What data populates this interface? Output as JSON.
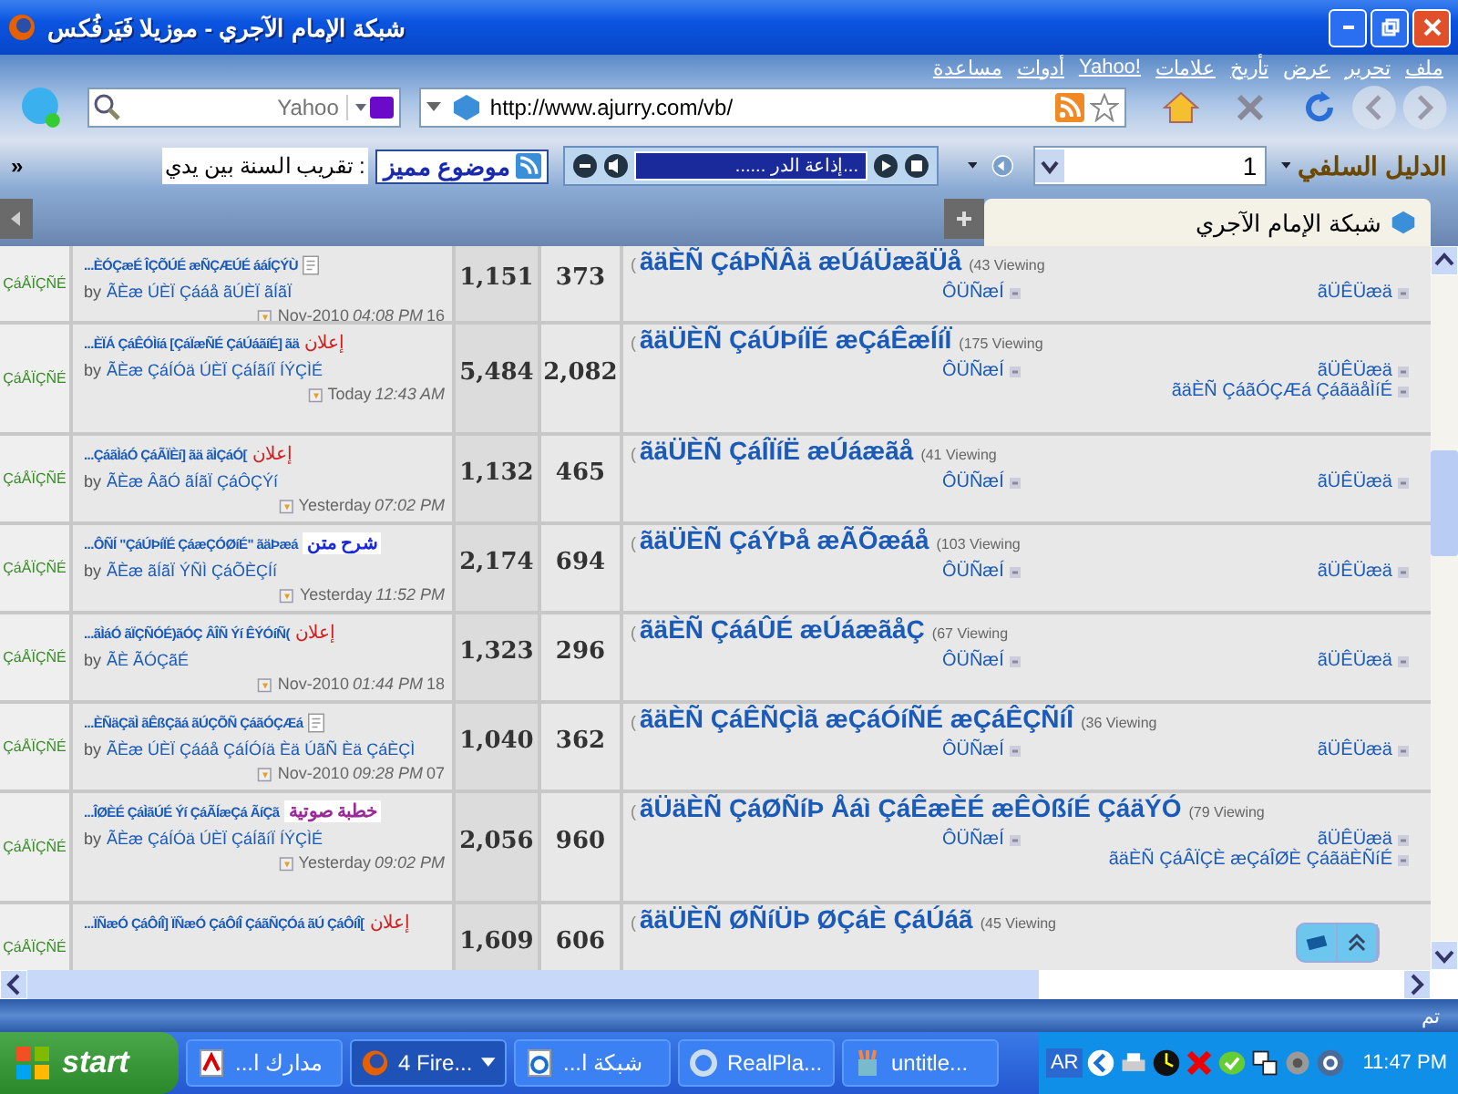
{
  "window": {
    "title": "شبكة الإمام الآجري - موزيلا فَيَرفُكس"
  },
  "menu": [
    "ملف",
    "تحرير",
    "عرض",
    "تأريخ",
    "علامات",
    "Yahoo!",
    "أدوات",
    "مساعدة"
  ],
  "search": {
    "placeholder": "Yahoo"
  },
  "address": {
    "value": "http://www.ajurry.com/vb/"
  },
  "toolbar": {
    "brand": "الدليل السلفي",
    "field_value": "1",
    "radio_station": "...إذاعة الدر ......",
    "featured": "موضوع مميز",
    "ticker": ": تقريب السنة بين يدي",
    "more": "»"
  },
  "tabs": [
    {
      "label": "شبكة الإمام الآجري",
      "selected": true
    }
  ],
  "forums": [
    {
      "prefix": "(",
      "title": "ãäÈÑ ÇáÞÑÂä æÚáÜæãÜå",
      "viewing": "(43 Viewing",
      "links": [
        "ÔÜÑæÍ",
        "ãÜÊÜæä"
      ],
      "column_2": "373",
      "column_3": "1,151",
      "last_post": {
        "title": "...ÈÓÇæÉ ÎÇÕÚÉ æÑÇÆÚÉ ááÍÇÝÙ",
        "attachment": true,
        "by": "by",
        "author": "ÃÈæ ÚÈÏ Çááå ãÚÈÏ ãÍãÏ",
        "date": "Nov-2010",
        "time": "04:08 PM",
        "day": "16"
      },
      "status": "ÇáÅÏÇÑÉ"
    },
    {
      "prefix": "(",
      "title": "ãäÜÈÑ ÇáÚÞíÏÉ æÇáÊæÍíÏ",
      "viewing": "(175 Viewing",
      "links": [
        "ÔÜÑæÍ",
        "ãÜÊÜæä"
      ],
      "extra_link": "ãäÈÑ ÇáãÓÇÆá ÇáãäåÌíÉ",
      "column_2": "2,082",
      "column_3": "5,484",
      "last_post": {
        "title": "...ÈÏÁ ÇáÊÓÌíá [ÇáÏæÑÉ ÇáÚáãíÉ] ãä",
        "tag": {
          "kind": "notice",
          "text": "إعلان"
        },
        "by": "by",
        "author": "ÃÈæ ÇáÍÓä ÚÈÏ ÇáÍãíÏ ÍÝÇÌÉ",
        "date": "Today",
        "time": "12:43 AM"
      },
      "status": "ÇáÅÏÇÑÉ"
    },
    {
      "prefix": "(",
      "title": "ãäÜÈÑ ÇáÍÏíË æÚáæãå",
      "viewing": "(41 Viewing",
      "links": [
        "ÔÜÑæÍ",
        "ãÜÊÜæä"
      ],
      "column_2": "465",
      "column_3": "1,132",
      "last_post": {
        "title": "...ÇáãÌáÓ ÇáÃÏÈí] ãä ãÌÇáÓ[",
        "tag": {
          "kind": "notice",
          "text": "إعلان"
        },
        "by": "by",
        "author": "ÃÈæ ÂãÓ ãÍãÏ ÇáÔÇÝí",
        "date": "Yesterday",
        "time": "07:02 PM"
      },
      "status": "ÇáÅÏÇÑÉ"
    },
    {
      "prefix": "(",
      "title": "ãäÜÈÑ ÇáÝÞå æÃÕæáå",
      "viewing": "(103 Viewing",
      "links": [
        "ÔÜÑæÍ",
        "ãÜÊÜæä"
      ],
      "column_2": "694",
      "column_3": "2,174",
      "last_post": {
        "title": "...ÔÑÍ \"ÇáÚÞíÏÉ ÇáæÇÓØíÉ\" ãäÞæá",
        "tag": {
          "kind": "lesson",
          "text": "شرح متن"
        },
        "by": "by",
        "author": "ÃÈæ ãÍãÏ ÝÑÌ ÇáÕÈÇÍí",
        "date": "Yesterday",
        "time": "11:52 PM"
      },
      "status": "ÇáÅÏÇÑÉ"
    },
    {
      "prefix": "(",
      "title": "ãäÈÑ ÇááÛÉ æÚáæãåÇ",
      "viewing": "(67 Viewing",
      "links": [
        "ÔÜÑæÍ",
        "ãÜÊÜæä"
      ],
      "column_2": "296",
      "column_3": "1,323",
      "last_post": {
        "title": "...ãÌáÓ ãÏÇÑÓÉ)ãÓÇ ÂÎÑ Ýí ÊÝÓíÑ(",
        "tag": {
          "kind": "notice",
          "text": "إعلان"
        },
        "by": "by",
        "author": "ÃÈ ÃÓÇãÉ",
        "date": "Nov-2010",
        "time": "01:44 PM",
        "day": "18"
      },
      "status": "ÇáÅÏÇÑÉ"
    },
    {
      "prefix": "(",
      "title": "ãäÈÑ ÇáÊÑÇÌã æÇáÓíÑÉ æÇáÊÇÑíÎ",
      "viewing": "(36 Viewing",
      "links": [
        "ÔÜÑæÍ",
        "ãÜÊÜæä"
      ],
      "column_2": "362",
      "column_3": "1,040",
      "last_post": {
        "title": "...ÈÑäÇãÌ ãÊßÇãá ãÚÇÕÑ ÇáãÓÇÆá",
        "attachment": true,
        "by": "by",
        "author": "ÃÈæ ÚÈÏ Çááå ÇáÍÓíä Èä ÚãÑ Èä ÇáÈÇÌ",
        "date": "Nov-2010",
        "time": "09:28 PM",
        "day": "07"
      },
      "status": "ÇáÅÏÇÑÉ"
    },
    {
      "prefix": "(",
      "title": "ãÜäÈÑ ÇáØÑíÞ Åáì ÇáÊæÈÉ æÊÒßíÉ ÇáäÝÓ",
      "viewing": "(79 Viewing",
      "links": [
        "ÔÜÑæÍ",
        "ãÜÊÜæä"
      ],
      "extra_link": "ãäÈÑ ÇáÂÏÇÈ æÇáÎØÈ ÇáãäÈÑíÉ",
      "column_2": "960",
      "column_3": "2,056",
      "last_post": {
        "title": "...ÎØÈÉ ÇáÌãÚÉ Ýí ÇáÃÍæÇá ÃíÇã",
        "tag": {
          "kind": "audio",
          "text": "خطبة صوتية"
        },
        "by": "by",
        "author": "ÃÈæ ÇáÍÓä ÚÈÏ ÇáÍãíÏ ÍÝÇÌÉ",
        "date": "Yesterday",
        "time": "09:02 PM"
      },
      "status": "ÇáÅÏÇÑÉ"
    },
    {
      "prefix": "(",
      "title": "ãäÜÈÑ ØÑíÜÞ ØÇáÈ ÇáÚáã",
      "viewing": "(45 Viewing",
      "column_2": "606",
      "column_3": "1,609",
      "last_post": {
        "title": "...ÏÑæÓ ÇáÔíÎ] ÏÑæÓ ÇáÔíÎ ÇáãÑÇÓá ãÚ ÇáÔíÎ[",
        "tag": {
          "kind": "notice",
          "text": "إعلان"
        }
      },
      "status": "ÇáÅÏÇÑÉ"
    }
  ],
  "status_bar": "تم",
  "taskbar": {
    "start": "start",
    "items": [
      {
        "kind": "pdf",
        "label": "...مدارك ا"
      },
      {
        "kind": "firefox",
        "label": "4 Fire..."
      },
      {
        "kind": "ie",
        "label": "...شبكة ا"
      },
      {
        "kind": "realplayer",
        "label": "RealPla..."
      },
      {
        "kind": "paint",
        "label": "untitle..."
      }
    ],
    "language": "AR",
    "clock": "11:47 PM"
  }
}
